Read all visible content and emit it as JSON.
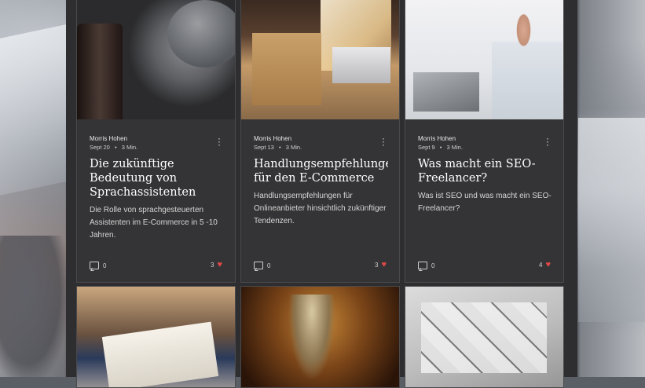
{
  "posts": [
    {
      "image_icon": "smart-speaker-image",
      "author": "Morris Hohen",
      "date": "Sept 20",
      "read_time": "3 Min.",
      "title": "Die zukünftige Bedeutung von Sprachassistenten für…",
      "excerpt": "Die Rolle von sprachgesteuerten Assistenten im E-Commerce in 5 -10 Jahren.",
      "comments": "0",
      "likes": "3"
    },
    {
      "image_icon": "packages-laptop-image",
      "author": "Morris Hohen",
      "date": "Sept 13",
      "read_time": "3 Min.",
      "title": "Handlungsempfehlungen für den E-Commerce",
      "excerpt": "Handlungsempfehlungen für Onlineanbieter hinsichtlich zukünftiger Tendenzen.",
      "comments": "0",
      "likes": "3"
    },
    {
      "image_icon": "man-writing-image",
      "author": "Morris Hohen",
      "date": "Sept 9",
      "read_time": "3 Min.",
      "title": "Was macht ein SEO-Freelancer?",
      "excerpt": "Was ist SEO und was macht ein SEO-Freelancer?",
      "comments": "0",
      "likes": "4"
    }
  ],
  "bottom_images": [
    "open-book-image",
    "justice-statue-image",
    "design-papers-image"
  ],
  "colors": {
    "heart": "#e04848",
    "card_bg": "#343436",
    "page_bg": "#2e2e30"
  },
  "separator": "•"
}
